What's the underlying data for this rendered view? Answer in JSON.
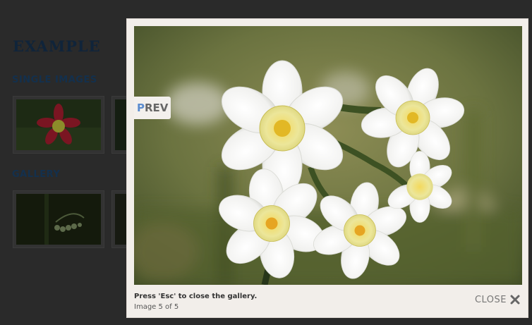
{
  "page": {
    "title": "EXAMPLE",
    "sections": [
      {
        "heading": "SINGLE IMAGES"
      },
      {
        "heading": "GALLERY"
      }
    ]
  },
  "lightbox": {
    "prev_label_first": "P",
    "prev_label_rest": "REV",
    "caption": "Press 'Esc' to close the gallery.",
    "counter": "Image 5 of 5",
    "close_label": "CLOSE",
    "current_image": 5,
    "total_images": 5
  },
  "icons": {
    "close": "close-icon"
  },
  "colors": {
    "lightbox_bg": "#f2eeea",
    "prev_accent": "#5b8ccf",
    "page_bg": "#2a2a2a",
    "heading": "#13304d"
  }
}
